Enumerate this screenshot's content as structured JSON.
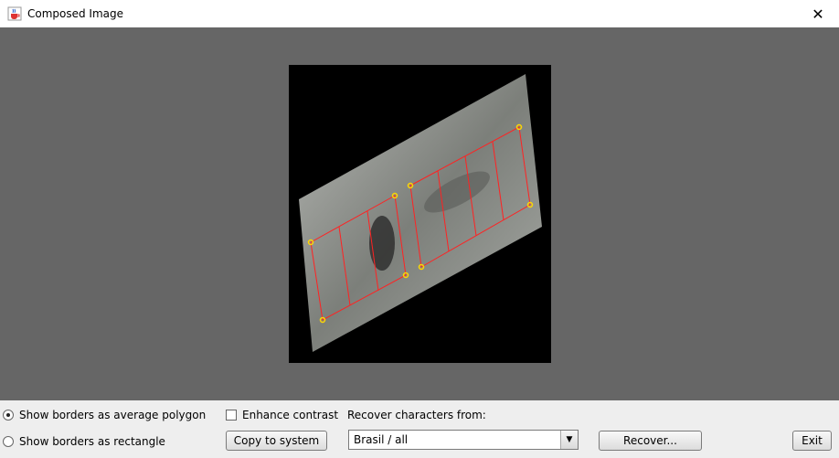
{
  "window": {
    "title": "Composed Image",
    "close_glyph": "✕"
  },
  "options": {
    "borders_polygon_label": "Show borders as average polygon",
    "borders_rectangle_label": "Show borders as rectangle",
    "enhance_contrast_label": "Enhance contrast",
    "recover_from_label": "Recover characters from:"
  },
  "buttons": {
    "copy_label": "Copy to system",
    "recover_label": "Recover...",
    "exit_label": "Exit"
  },
  "recover_select": {
    "value": "Brasil / all",
    "arrow": "▼"
  },
  "colors": {
    "canvas_bg": "#666666",
    "border_line": "#ff2222",
    "vertex": "#ffd700"
  },
  "icons": {
    "app": "java-cup-icon",
    "close": "close-icon"
  }
}
